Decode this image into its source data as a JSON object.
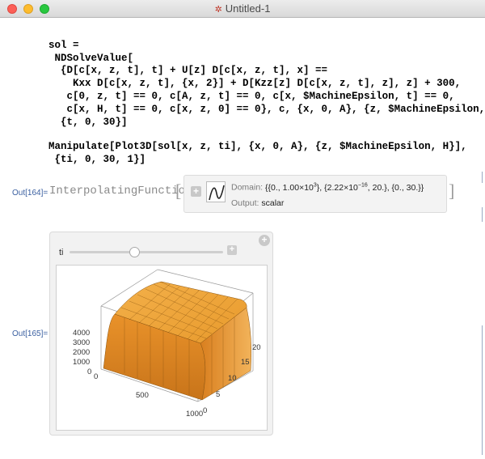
{
  "window": {
    "title": "Untitled-1"
  },
  "code1": {
    "lines": [
      "sol =",
      " NDSolveValue[",
      "  {D[c[x, z, t], t] + U[z] D[c[x, z, t], x] ==",
      "    Kxx D[c[x, z, t], {x, 2}] + D[Kzz[z] D[c[x, z, t], z], z] + 300,",
      "   c[0, z, t] == 0, c[A, z, t] == 0, c[x, $MachineEpsilon, t] == 0,",
      "   c[x, H, t] == 0, c[x, z, 0] == 0}, c, {x, 0, A}, {z, $MachineEpsilon, H},",
      "  {t, 0, 30}]"
    ]
  },
  "code2": {
    "lines": [
      "Manipulate[Plot3D[sol[x, z, ti], {x, 0, A}, {z, $MachineEpsilon, H}],",
      " {ti, 0, 30, 1}]"
    ]
  },
  "out164": {
    "label": "Out[164]=",
    "head": "InterpolatingFunction",
    "domain_label": "Domain:",
    "domain_value": "{{0., 1.00×10",
    "domain_exp1": "3",
    "domain_mid": "}, {2.22×10",
    "domain_exp2": "−16",
    "domain_tail": ", 20.}, {0., 30.}}",
    "output_label": "Output:",
    "output_value": "scalar"
  },
  "out165": {
    "label": "Out[165]=",
    "slider": {
      "name": "ti",
      "value": 15,
      "min": 0,
      "max": 30,
      "step": 1
    },
    "plot": {
      "z_ticks": [
        "4000",
        "3000",
        "2000",
        "1000",
        "0"
      ],
      "x_ticks": [
        "0",
        "500",
        "1000"
      ],
      "y_ticks": [
        "0",
        "5",
        "10",
        "15",
        "20"
      ],
      "surface_color": "#f0a030"
    }
  },
  "colors": {
    "accent": "#3b6d9e",
    "out_label": "#3a5fa0"
  }
}
